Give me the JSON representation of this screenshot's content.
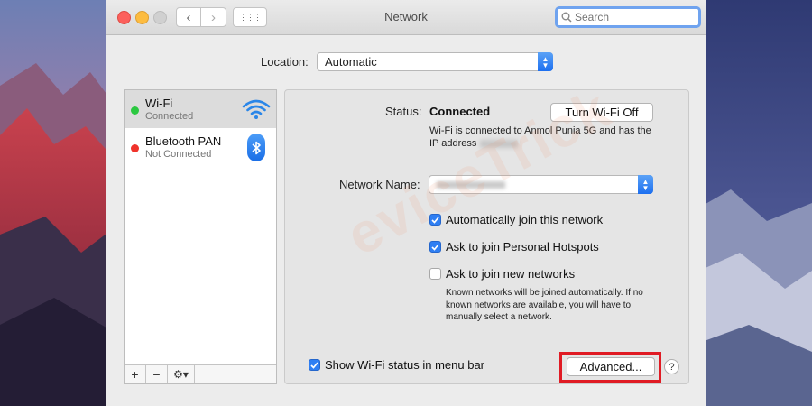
{
  "window": {
    "title": "Network"
  },
  "toolbar": {
    "back_glyph": "‹",
    "forward_glyph": "›",
    "grid_glyph": "⋮⋮⋮",
    "search_placeholder": "Search"
  },
  "location": {
    "label": "Location:",
    "value": "Automatic"
  },
  "services": [
    {
      "name": "Wi-Fi",
      "status": "Connected",
      "status_color": "#2bc840",
      "icon": "wifi-icon",
      "selected": true
    },
    {
      "name": "Bluetooth PAN",
      "status": "Not Connected",
      "status_color": "#f0332b",
      "icon": "bluetooth-icon",
      "selected": false
    }
  ],
  "sidebar_controls": {
    "add": "+",
    "remove": "−",
    "gear": "⚙▾"
  },
  "detail": {
    "status_label": "Status:",
    "status_value": "Connected",
    "turn_off_label": "Turn Wi-Fi Off",
    "status_desc": "Wi-Fi is connected to Anmol Punia 5G and has the IP address",
    "network_name_label": "Network Name:",
    "checkboxes": [
      {
        "label": "Automatically join this network",
        "checked": true
      },
      {
        "label": "Ask to join Personal Hotspots",
        "checked": true
      },
      {
        "label": "Ask to join new networks",
        "checked": false
      }
    ],
    "note": "Known networks will be joined automatically. If no known networks are available, you will have to manually select a network.",
    "show_status_label": "Show Wi-Fi status in menu bar",
    "show_status_checked": true,
    "advanced_label": "Advanced...",
    "help_label": "?"
  },
  "watermark": "eviceTrick",
  "colors": {
    "accent": "#2f7ff3",
    "highlight": "#e01b24"
  }
}
